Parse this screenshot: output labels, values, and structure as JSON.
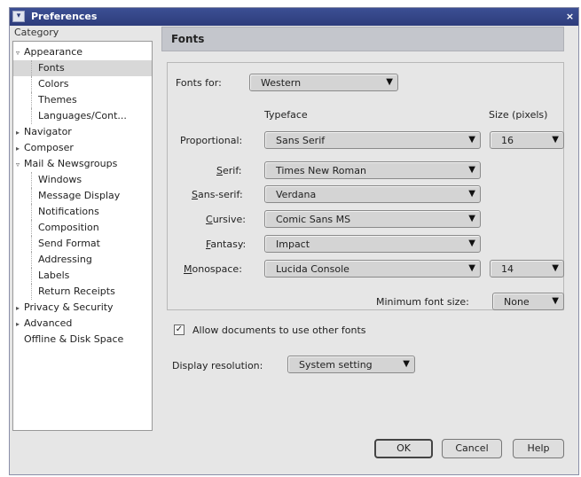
{
  "window": {
    "title": "Preferences",
    "close_glyph": "×",
    "menu_glyph": "▾"
  },
  "category": {
    "label": "Category",
    "items": [
      {
        "label": "Appearance",
        "toggle": "▿"
      },
      {
        "label": "Fonts"
      },
      {
        "label": "Colors"
      },
      {
        "label": "Themes"
      },
      {
        "label": "Languages/Cont..."
      },
      {
        "label": "Navigator",
        "toggle": "▸"
      },
      {
        "label": "Composer",
        "toggle": "▸"
      },
      {
        "label": "Mail & Newsgroups",
        "toggle": "▿"
      },
      {
        "label": "Windows"
      },
      {
        "label": "Message Display"
      },
      {
        "label": "Notifications"
      },
      {
        "label": "Composition"
      },
      {
        "label": "Send Format"
      },
      {
        "label": "Addressing"
      },
      {
        "label": "Labels"
      },
      {
        "label": "Return Receipts"
      },
      {
        "label": "Privacy & Security",
        "toggle": "▸"
      },
      {
        "label": "Advanced",
        "toggle": "▸"
      },
      {
        "label": "Offline & Disk Space"
      }
    ],
    "selected": "Fonts"
  },
  "panel": {
    "title": "Fonts",
    "fonts_for_label": "Fonts for:",
    "fonts_for_value": "Western",
    "typeface_header": "Typeface",
    "size_header": "Size (pixels)",
    "rows": {
      "proportional": {
        "label": "Proportional:",
        "value": "Sans Serif",
        "size": "16"
      },
      "serif": {
        "label": "Serif:",
        "value": "Times New Roman"
      },
      "sans_serif": {
        "label": "Sans-serif:",
        "value": "Verdana"
      },
      "cursive": {
        "label": "Cursive:",
        "value": "Comic Sans MS"
      },
      "fantasy": {
        "label": "Fantasy:",
        "value": "Impact"
      },
      "monospace": {
        "label": "Monospace:",
        "value": "Lucida Console",
        "size": "14"
      }
    },
    "min_font_label": "Minimum font size:",
    "min_font_value": "None",
    "allow_docs_label": "Allow documents to use other fonts",
    "allow_docs_checked": true,
    "display_resolution_label": "Display resolution:",
    "display_resolution_value": "System setting",
    "arrow_glyph": "▼"
  },
  "buttons": {
    "ok": "OK",
    "cancel": "Cancel",
    "help": "Help"
  }
}
